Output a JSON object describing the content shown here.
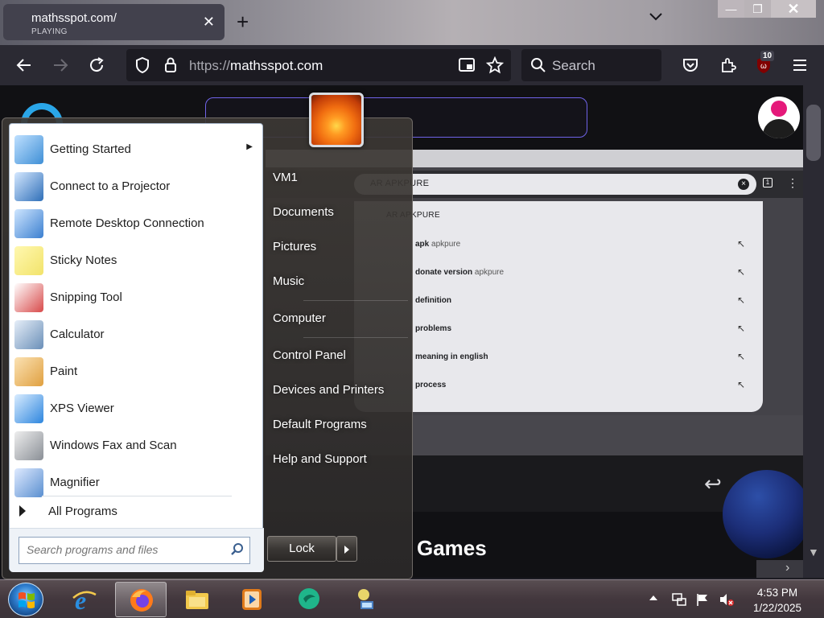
{
  "browser": {
    "tab": {
      "title": "mathsspot.com/",
      "subtitle": "PLAYING",
      "close_glyph": "✕"
    },
    "new_tab_glyph": "+",
    "url": "https://mathsspot.com",
    "url_scheme": "https://",
    "url_host": "mathsspot.com",
    "search_label": "Search",
    "extension_badge": "10",
    "window_controls": {
      "minimize": "—",
      "maximize": "❐",
      "close": "✕"
    }
  },
  "page": {
    "embedded_search": {
      "query": "AR APKPURE",
      "suggestions": [
        {
          "bold": "AR APKPURE",
          "rest": ""
        },
        {
          "bold": "apk",
          "rest": " apkpure"
        },
        {
          "bold": "donate version",
          "rest": " apkpure"
        },
        {
          "bold": "definition",
          "rest": ""
        },
        {
          "bold": "problems",
          "rest": ""
        },
        {
          "bold": "meaning in english",
          "rest": ""
        },
        {
          "bold": "process",
          "rest": ""
        }
      ]
    },
    "section_title": "Games"
  },
  "start_menu": {
    "programs": [
      {
        "label": "Getting Started",
        "icon": "getting-started-icon",
        "color": "#3f8fd6",
        "submenu": "▶"
      },
      {
        "label": "Connect to a Projector",
        "icon": "projector-icon",
        "color": "#2f6fb8"
      },
      {
        "label": "Remote Desktop Connection",
        "icon": "remote-desktop-icon",
        "color": "#3b7fd0"
      },
      {
        "label": "Sticky Notes",
        "icon": "sticky-notes-icon",
        "color": "#f2e36a"
      },
      {
        "label": "Snipping Tool",
        "icon": "snipping-tool-icon",
        "color": "#d84a4a"
      },
      {
        "label": "Calculator",
        "icon": "calculator-icon",
        "color": "#6a8fb8"
      },
      {
        "label": "Paint",
        "icon": "paint-icon",
        "color": "#e0a040"
      },
      {
        "label": "XPS Viewer",
        "icon": "xps-viewer-icon",
        "color": "#2e86de"
      },
      {
        "label": "Windows Fax and Scan",
        "icon": "fax-scan-icon",
        "color": "#8a8f96"
      },
      {
        "label": "Magnifier",
        "icon": "magnifier-icon",
        "color": "#5a8fd0"
      }
    ],
    "all_programs": "All Programs",
    "search_placeholder": "Search programs and files",
    "right_items": [
      "VM1",
      "Documents",
      "Pictures",
      "Music",
      "Computer",
      "Control Panel",
      "Devices and Printers",
      "Default Programs",
      "Help and Support"
    ],
    "lock_label": "Lock"
  },
  "taskbar": {
    "apps": [
      {
        "name": "internet-explorer-icon",
        "color": "#2a8ee0"
      },
      {
        "name": "firefox-icon",
        "color": "#ff7a1a",
        "active": true
      },
      {
        "name": "file-explorer-icon",
        "color": "#f2c94c"
      },
      {
        "name": "media-player-icon",
        "color": "#e07a1a"
      },
      {
        "name": "chat-app-icon",
        "color": "#1fb58a"
      },
      {
        "name": "network-app-icon",
        "color": "#e8d56a"
      }
    ],
    "clock_time": "4:53 PM",
    "clock_date": "1/22/2025"
  }
}
